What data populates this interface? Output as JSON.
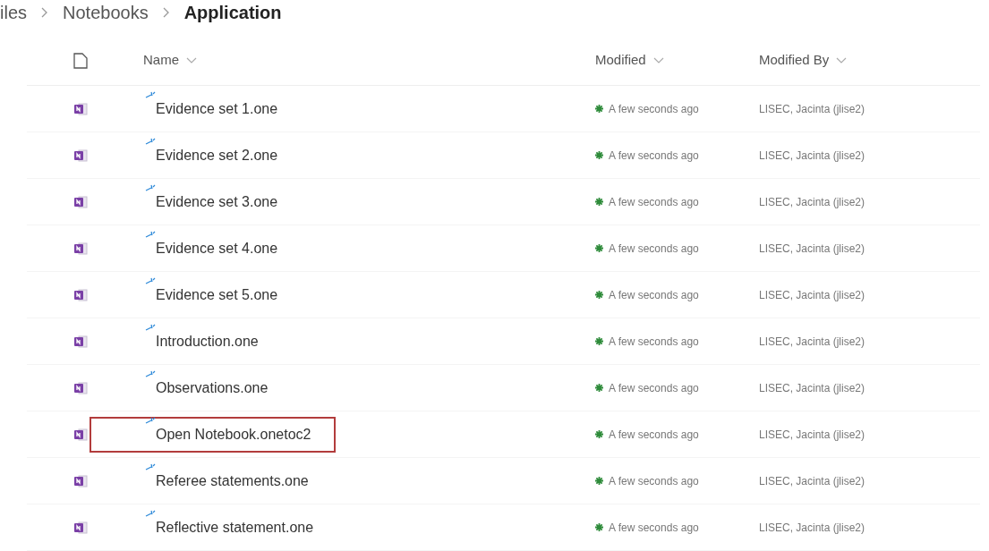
{
  "breadcrumb": [
    {
      "label": "iles",
      "current": false
    },
    {
      "label": "Notebooks",
      "current": false
    },
    {
      "label": "Application",
      "current": true
    }
  ],
  "columns": [
    {
      "label": "Name"
    },
    {
      "label": "Modified"
    },
    {
      "label": "Modified By"
    }
  ],
  "rows": [
    {
      "name": "Evidence set 1.one",
      "modified": "A few seconds ago",
      "modified_by": "LISEC, Jacinta (jlise2)",
      "highlighted": false
    },
    {
      "name": "Evidence set 2.one",
      "modified": "A few seconds ago",
      "modified_by": "LISEC, Jacinta (jlise2)",
      "highlighted": false
    },
    {
      "name": "Evidence set 3.one",
      "modified": "A few seconds ago",
      "modified_by": "LISEC, Jacinta (jlise2)",
      "highlighted": false
    },
    {
      "name": "Evidence set 4.one",
      "modified": "A few seconds ago",
      "modified_by": "LISEC, Jacinta (jlise2)",
      "highlighted": false
    },
    {
      "name": "Evidence set 5.one",
      "modified": "A few seconds ago",
      "modified_by": "LISEC, Jacinta (jlise2)",
      "highlighted": false
    },
    {
      "name": "Introduction.one",
      "modified": "A few seconds ago",
      "modified_by": "LISEC, Jacinta (jlise2)",
      "highlighted": false
    },
    {
      "name": "Observations.one",
      "modified": "A few seconds ago",
      "modified_by": "LISEC, Jacinta (jlise2)",
      "highlighted": false
    },
    {
      "name": "Open Notebook.onetoc2",
      "modified": "A few seconds ago",
      "modified_by": "LISEC, Jacinta (jlise2)",
      "highlighted": true
    },
    {
      "name": "Referee statements.one",
      "modified": "A few seconds ago",
      "modified_by": "LISEC, Jacinta (jlise2)",
      "highlighted": false
    },
    {
      "name": "Reflective statement.one",
      "modified": "A few seconds ago",
      "modified_by": "LISEC, Jacinta (jlise2)",
      "highlighted": false
    }
  ]
}
